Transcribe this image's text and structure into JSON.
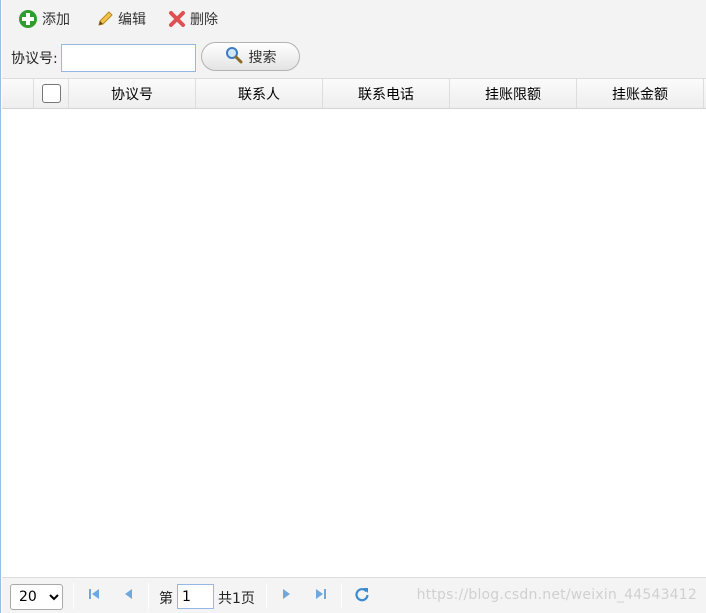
{
  "toolbar": {
    "add_label": "添加",
    "edit_label": "编辑",
    "delete_label": "删除"
  },
  "search": {
    "label": "协议号:",
    "value": "",
    "button_label": "搜索"
  },
  "grid": {
    "columns": [
      "协议号",
      "联系人",
      "联系电话",
      "挂账限额",
      "挂账金额"
    ],
    "rows": []
  },
  "pager": {
    "page_size": "20",
    "page_size_options": [
      "20"
    ],
    "page_prefix": "第",
    "current_page": "1",
    "total_pages_text": "共1页"
  },
  "watermark": "https://blog.csdn.net/weixin_44543412",
  "colors": {
    "accent_border": "#95b8e7",
    "add_icon": "#2e9e2e",
    "delete_icon": "#e05050",
    "pager_icon": "#6fa8dc"
  }
}
